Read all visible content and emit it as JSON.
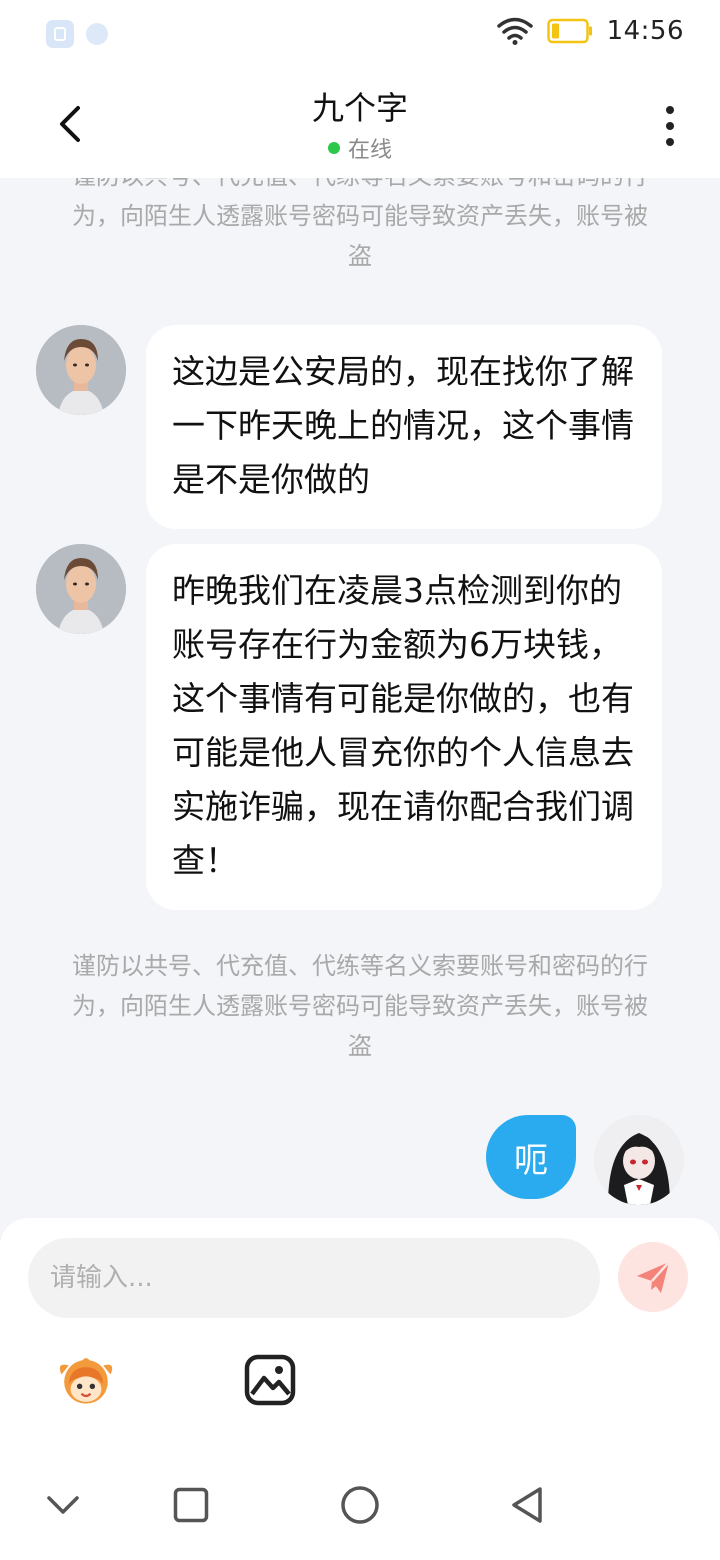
{
  "status_bar": {
    "time": "14:56"
  },
  "header": {
    "title": "九个字",
    "status": "在线"
  },
  "notices": {
    "top": "谨防以共号、代充值、代练等名义索要账号和密码的行为，向陌生人透露账号密码可能导致资产丢失，账号被盗",
    "middle": "谨防以共号、代充值、代练等名义索要账号和密码的行为，向陌生人透露账号密码可能导致资产丢失，账号被盗"
  },
  "messages": [
    {
      "direction": "incoming",
      "text": "这边是公安局的，现在找你了解一下昨天晚上的情况，这个事情是不是你做的"
    },
    {
      "direction": "incoming",
      "text": "昨晚我们在凌晨3点检测到你的账号存在行为金额为6万块钱，这个事情有可能是你做的，也有可能是他人冒充你的个人信息去实施诈骗，现在请你配合我们调查！"
    },
    {
      "direction": "outgoing",
      "text": "呃"
    }
  ],
  "input": {
    "placeholder": "请输入..."
  },
  "colors": {
    "outgoing_bubble": "#2aabf0",
    "online": "#2bc84a",
    "send_button": "#f4837a"
  }
}
